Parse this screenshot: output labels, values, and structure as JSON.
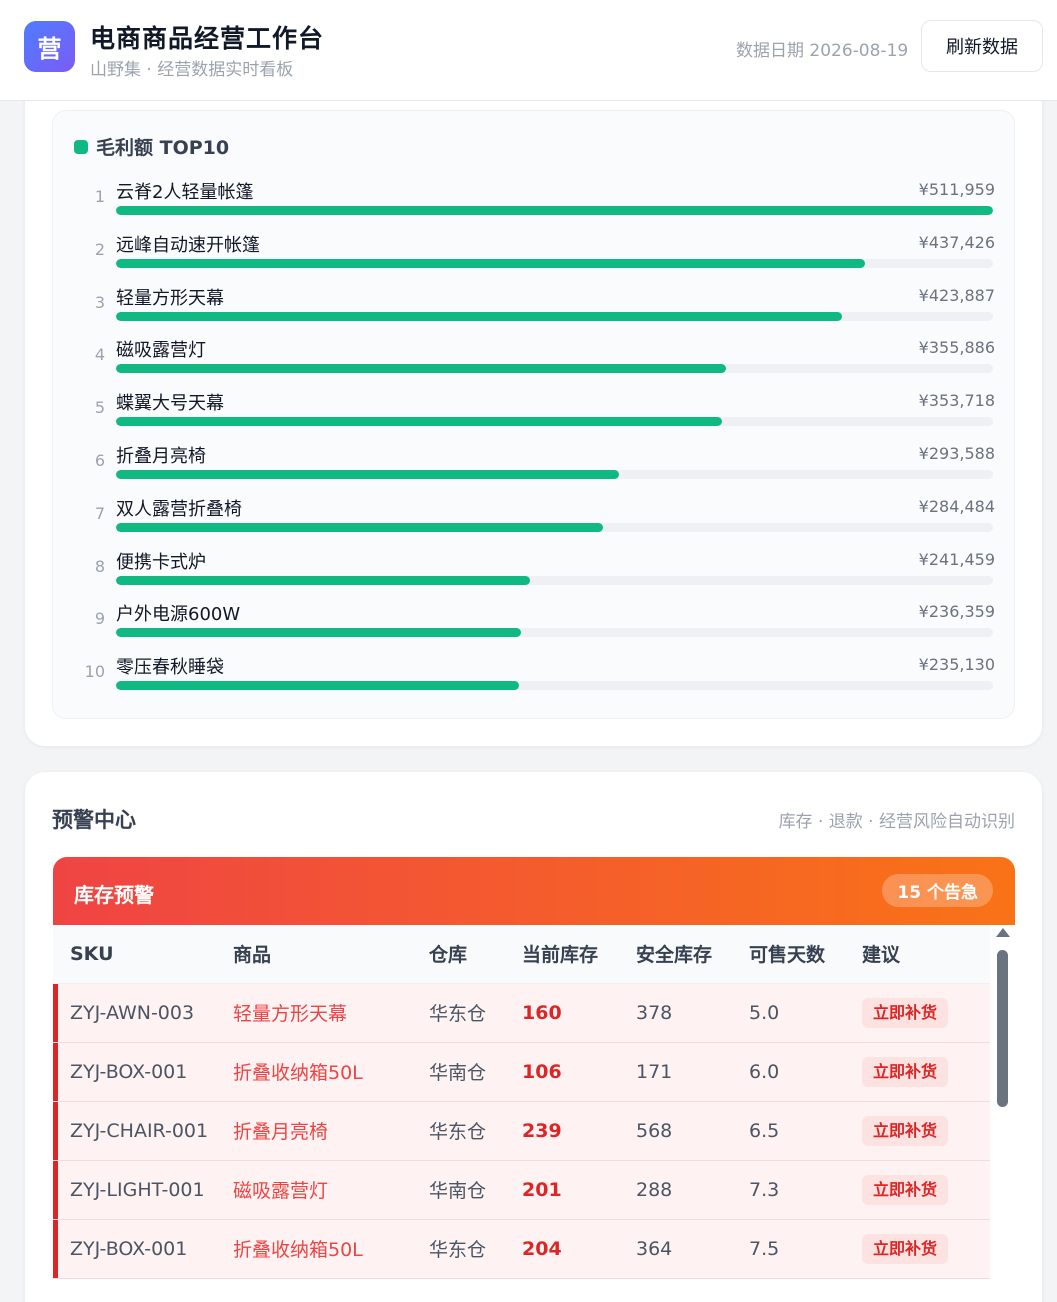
{
  "header": {
    "logo_text": "营",
    "title": "电商商品经营工作台",
    "subtitle": "山野集 · 经营数据实时看板",
    "date_label": "数据日期 2026-08-19",
    "refresh_label": "刷新数据"
  },
  "top10": {
    "title": "毛利额 TOP10",
    "accent": "#10b981",
    "items": [
      {
        "rank": "1",
        "name": "云脊2人轻量帐篷",
        "value": "¥511,959",
        "amount": 511959
      },
      {
        "rank": "2",
        "name": "远峰自动速开帐篷",
        "value": "¥437,426",
        "amount": 437426
      },
      {
        "rank": "3",
        "name": "轻量方形天幕",
        "value": "¥423,887",
        "amount": 423887
      },
      {
        "rank": "4",
        "name": "磁吸露营灯",
        "value": "¥355,886",
        "amount": 355886
      },
      {
        "rank": "5",
        "name": "蝶翼大号天幕",
        "value": "¥353,718",
        "amount": 353718
      },
      {
        "rank": "6",
        "name": "折叠月亮椅",
        "value": "¥293,588",
        "amount": 293588
      },
      {
        "rank": "7",
        "name": "双人露营折叠椅",
        "value": "¥284,484",
        "amount": 284484
      },
      {
        "rank": "8",
        "name": "便携卡式炉",
        "value": "¥241,459",
        "amount": 241459
      },
      {
        "rank": "9",
        "name": "户外电源600W",
        "value": "¥236,359",
        "amount": 236359
      },
      {
        "rank": "10",
        "name": "零压春秋睡袋",
        "value": "¥235,130",
        "amount": 235130
      }
    ]
  },
  "alerts": {
    "title": "预警中心",
    "subtitle": "库存 · 退款 · 经营风险自动识别",
    "stock": {
      "title": "库存预警",
      "badge": "15 个告急",
      "columns": [
        "SKU",
        "商品",
        "仓库",
        "当前库存",
        "安全库存",
        "可售天数",
        "建议"
      ],
      "rows": [
        {
          "sku": "ZYJ-AWN-003",
          "product": "轻量方形天幕",
          "warehouse": "华东仓",
          "stock": "160",
          "safe": "378",
          "days": "5.0",
          "action": "立即补货"
        },
        {
          "sku": "ZYJ-BOX-001",
          "product": "折叠收纳箱50L",
          "warehouse": "华南仓",
          "stock": "106",
          "safe": "171",
          "days": "6.0",
          "action": "立即补货"
        },
        {
          "sku": "ZYJ-CHAIR-001",
          "product": "折叠月亮椅",
          "warehouse": "华东仓",
          "stock": "239",
          "safe": "568",
          "days": "6.5",
          "action": "立即补货"
        },
        {
          "sku": "ZYJ-LIGHT-001",
          "product": "磁吸露营灯",
          "warehouse": "华南仓",
          "stock": "201",
          "safe": "288",
          "days": "7.3",
          "action": "立即补货"
        },
        {
          "sku": "ZYJ-BOX-001",
          "product": "折叠收纳箱50L",
          "warehouse": "华东仓",
          "stock": "204",
          "safe": "364",
          "days": "7.5",
          "action": "立即补货"
        }
      ]
    }
  }
}
